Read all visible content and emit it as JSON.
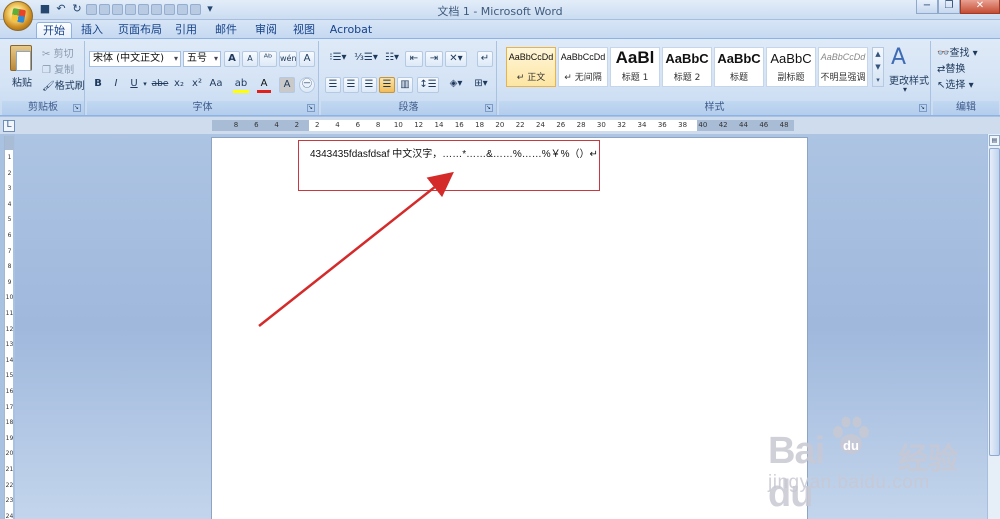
{
  "window": {
    "title": "文档 1 - Microsoft Word",
    "controls": {
      "minimize": "−",
      "restore": "❐",
      "close": "✕"
    }
  },
  "tabs": [
    {
      "label": "开始",
      "active": true
    },
    {
      "label": "插入"
    },
    {
      "label": "页面布局"
    },
    {
      "label": "引用"
    },
    {
      "label": "邮件"
    },
    {
      "label": "审阅"
    },
    {
      "label": "视图"
    },
    {
      "label": "Acrobat"
    }
  ],
  "ribbon": {
    "clipboard": {
      "group_label": "剪贴板",
      "paste": "粘贴",
      "cut": "剪切",
      "copy": "复制",
      "format_painter": "格式刷"
    },
    "font": {
      "group_label": "字体",
      "font_name": "宋体 (中文正文)",
      "font_size": "五号",
      "grow": "A",
      "shrink": "A",
      "bold": "B",
      "italic": "I",
      "underline": "U",
      "strike": "abe",
      "subscript": "x₂",
      "superscript": "x²",
      "change_case": "Aa",
      "highlight_color": "#ffff00",
      "font_color": "#e0201a"
    },
    "paragraph": {
      "group_label": "段落"
    },
    "styles": {
      "group_label": "样式",
      "items": [
        {
          "sample": "AaBbCcDd",
          "name": "↵ 正文",
          "selected": true
        },
        {
          "sample": "AaBbCcDd",
          "name": "↵ 无间隔"
        },
        {
          "sample": "AaBl",
          "name": "标题 1"
        },
        {
          "sample": "AaBbC",
          "name": "标题 2"
        },
        {
          "sample": "AaBbC",
          "name": "标题"
        },
        {
          "sample": "AaBbC",
          "name": "副标题"
        },
        {
          "sample": "AaBbCcDd",
          "name": "不明显强调"
        }
      ],
      "change_styles": "更改样式"
    },
    "editing": {
      "group_label": "编辑",
      "find": "查找",
      "replace": "替换",
      "select": "选择"
    }
  },
  "ruler": {
    "h_numbers": [
      "8",
      "6",
      "4",
      "2",
      "2",
      "4",
      "6",
      "8",
      "10",
      "12",
      "14",
      "16",
      "18",
      "20",
      "22",
      "24",
      "26",
      "28",
      "30",
      "32",
      "34",
      "36",
      "38",
      "40",
      "42",
      "44",
      "46",
      "48"
    ],
    "v_numbers": [
      "1",
      "2",
      "3",
      "4",
      "5",
      "6",
      "7",
      "8",
      "9",
      "10",
      "11",
      "12",
      "13",
      "14",
      "15",
      "16",
      "17",
      "18",
      "19",
      "20",
      "21",
      "22",
      "23",
      "24"
    ]
  },
  "document": {
    "text": "4343435fdasfdsaf 中文汉字，……*……&……%……%￥%（）↵"
  },
  "watermark": {
    "logo": "Bai  du",
    "brand": "经验",
    "url": "jingyan.baidu.com"
  },
  "colors": {
    "annotation_red": "#d42a2a",
    "ribbon_blue": "#c7daf1"
  }
}
